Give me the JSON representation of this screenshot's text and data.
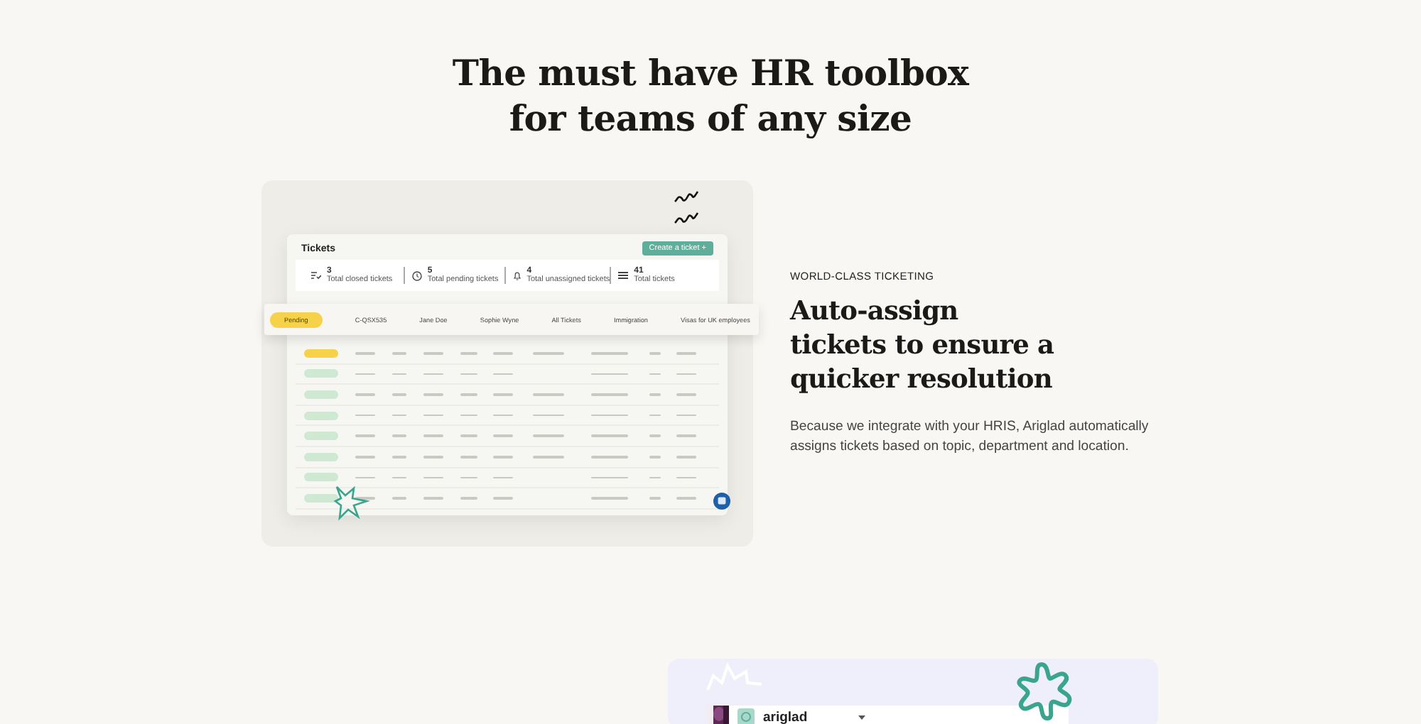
{
  "heading": {
    "lines": [
      "The must have HR toolbox",
      "for teams of any size"
    ]
  },
  "tickets_panel": {
    "title": "Tickets",
    "create_button": "Create a ticket +",
    "stats": [
      {
        "kind": "closed",
        "value": "3",
        "label": "Total closed tickets"
      },
      {
        "kind": "pending",
        "value": "5",
        "label": "Total pending tickets"
      },
      {
        "kind": "unassigned",
        "value": "4",
        "label": "Total unassigned tickets"
      },
      {
        "kind": "total",
        "value": "41",
        "label": "Total tickets"
      }
    ],
    "highlight_row": {
      "status": {
        "label": "Pending",
        "kind": "pending"
      },
      "cells": [
        "C-QSX535",
        "Jane Doe",
        "Sophie Wyne",
        "All Tickets",
        "Immigration",
        "Visas for UK employees"
      ]
    },
    "rows": [
      {
        "kind": "pending",
        "has_category": true
      },
      {
        "kind": "assigned",
        "has_category": false
      },
      {
        "kind": "assigned",
        "has_category": true
      },
      {
        "kind": "assigned",
        "has_category": true
      },
      {
        "kind": "assigned",
        "has_category": true
      },
      {
        "kind": "assigned",
        "has_category": true
      },
      {
        "kind": "assigned",
        "has_category": false
      },
      {
        "kind": "assigned",
        "has_category": false
      }
    ]
  },
  "feature": {
    "eyebrow": "WORLD-CLASS TICKETING",
    "title_lines": [
      "Auto-assign",
      "tickets to ensure a",
      "quicker resolution"
    ],
    "body": "Because we integrate with your HRIS, Ariglad automatically assigns tickets based on topic, department and location."
  },
  "chat_preview": {
    "workspace": "ariglad"
  }
}
